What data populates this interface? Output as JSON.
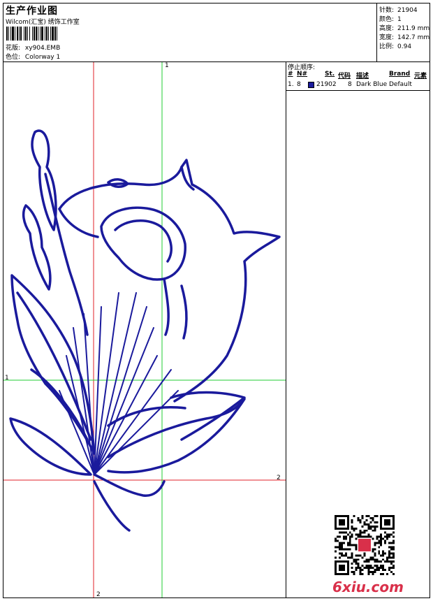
{
  "header": {
    "title": "生产作业图",
    "subtitle": "Wilcom(汇宝) 绣饰工作室",
    "design_label": "花版:",
    "design_value": "xy904.EMB",
    "color_label": "色位:",
    "color_value": "Colorway 1"
  },
  "stats": [
    {
      "label": "针数:",
      "value": "21904"
    },
    {
      "label": "颜色:",
      "value": "1"
    },
    {
      "label": "高度:",
      "value": "211.9 mm"
    },
    {
      "label": "宽度:",
      "value": "142.7 mm"
    },
    {
      "label": "比例:",
      "value": "0.94"
    }
  ],
  "stop_sequence": {
    "label": "停止顺序:",
    "columns": [
      "#",
      "N#",
      "St.",
      "代码",
      "描述",
      "Brand",
      "元素"
    ],
    "rows": [
      {
        "num": "1.",
        "needle": "8",
        "stitches": "21902",
        "code": "8",
        "description": "Dark Blue",
        "brand": "Default",
        "swatch_color": "#1a1a9c"
      }
    ]
  },
  "axis_labels": {
    "green_top": "1",
    "green_left": "1",
    "red_right": "2",
    "red_bottom": "2"
  },
  "colors": {
    "thread": "#1a1a9c",
    "red_axis": "#e0202a",
    "green_axis": "#22cc33",
    "watermark": "#d9304a"
  },
  "watermark": "6xiu.com"
}
